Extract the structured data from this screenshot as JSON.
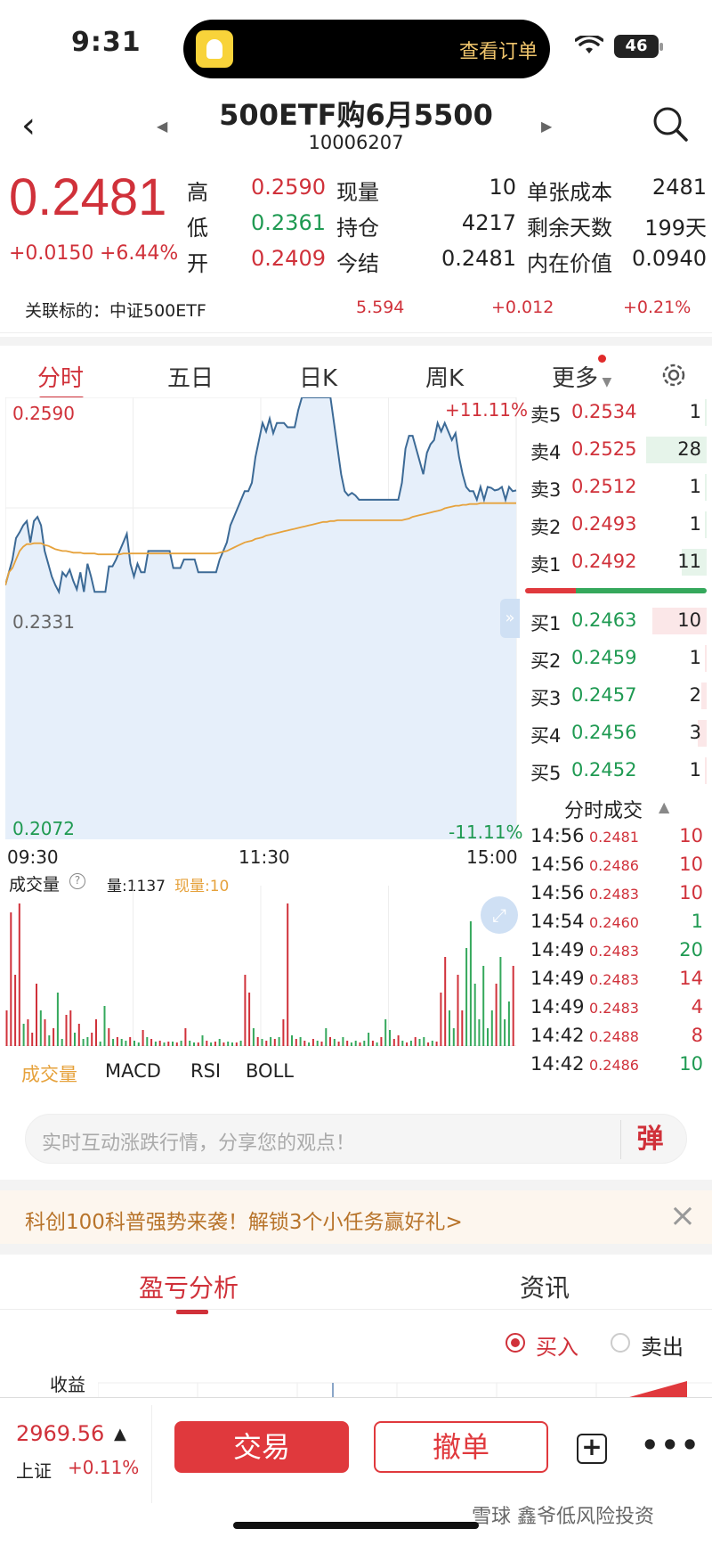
{
  "status": {
    "time": "9:31",
    "island_link": "查看订单",
    "battery": "46"
  },
  "header": {
    "title": "500ETF购6月5500",
    "code": "10006207"
  },
  "quote": {
    "price": "0.2481",
    "change": "+0.0150",
    "change_pct": "+6.44%",
    "rows": [
      [
        {
          "l": "高",
          "v": "0.2590"
        },
        {
          "l": "现量",
          "v": "10"
        },
        {
          "l": "单张成本",
          "v": "2481"
        }
      ],
      [
        {
          "l": "低",
          "v": "0.2361"
        },
        {
          "l": "持仓",
          "v": "4217"
        },
        {
          "l": "剩余天数",
          "v": "199天"
        }
      ],
      [
        {
          "l": "开",
          "v": "0.2409"
        },
        {
          "l": "今结",
          "v": "0.2481"
        },
        {
          "l": "内在价值",
          "v": "0.0940"
        }
      ]
    ]
  },
  "related": {
    "label": "关联标的：中证500ETF",
    "price": "5.594",
    "change": "+0.012",
    "pct": "+0.21%"
  },
  "tabs": [
    "分时",
    "五日",
    "日K",
    "周K",
    "更多"
  ],
  "chart_data": {
    "type": "line",
    "price_max": "0.2590",
    "price_mid": "0.2331",
    "price_min": "0.2072",
    "pct_max": "+11.11%",
    "pct_min": "-11.11%",
    "x_labels": [
      "09:30",
      "11:30",
      "15:00"
    ],
    "ylim": [
      0.2072,
      0.259
    ],
    "series": [
      {
        "values": [
          0.237,
          0.2385,
          0.24,
          0.2425,
          0.2432,
          0.244,
          0.2445,
          0.242,
          0.2445,
          0.245,
          0.244,
          0.241,
          0.2395,
          0.238,
          0.237,
          0.2362,
          0.2385,
          0.238,
          0.2388,
          0.2375,
          0.2365,
          0.2385,
          0.2362,
          0.2395,
          0.238,
          0.2362,
          0.2362,
          0.2362,
          0.2362,
          0.2392,
          0.2392,
          0.24,
          0.241,
          0.242,
          0.243,
          0.2395,
          0.238,
          0.2395,
          0.2385,
          0.2385,
          0.241,
          0.241,
          0.241,
          0.241,
          0.241,
          0.241,
          0.241,
          0.239,
          0.239,
          0.239,
          0.24,
          0.24,
          0.24,
          0.24,
          0.2385,
          0.2385,
          0.2385,
          0.2385,
          0.2385,
          0.2385,
          0.24,
          0.241,
          0.242,
          0.244,
          0.245,
          0.246,
          0.247,
          0.248,
          0.248,
          0.249,
          0.252,
          0.254,
          0.256,
          0.255,
          0.2565,
          0.2548,
          0.256,
          0.256,
          0.256,
          0.2555,
          0.2555,
          0.2555,
          0.2575,
          0.259,
          0.259,
          0.259,
          0.259,
          0.259,
          0.259,
          0.259,
          0.259,
          0.259,
          0.256,
          0.253,
          0.25,
          0.248,
          0.2475,
          0.2478,
          0.2475,
          0.247,
          0.247,
          0.247,
          0.247,
          0.247,
          0.247,
          0.247,
          0.247,
          0.247,
          0.247,
          0.247,
          0.247,
          0.249,
          0.253,
          0.2545,
          0.2545,
          0.253,
          0.2515,
          0.25,
          0.2525,
          0.2535,
          0.254,
          0.256,
          0.255,
          0.256,
          0.255,
          0.254,
          0.2548,
          0.252,
          0.25,
          0.2485,
          0.248,
          0.248,
          0.247,
          0.2485,
          0.247,
          0.2485,
          0.2484,
          0.2481,
          0.2482,
          0.2485,
          0.247,
          0.2485,
          0.248,
          0.2481
        ]
      },
      {
        "values": [
          0.237,
          0.2385,
          0.239,
          0.24,
          0.241,
          0.2415,
          0.2418,
          0.2418,
          0.2419,
          0.2419,
          0.2419,
          0.2417,
          0.2416,
          0.2414,
          0.2412,
          0.2411,
          0.241,
          0.241,
          0.2409,
          0.2408,
          0.2408,
          0.2408,
          0.2407,
          0.2407,
          0.2407,
          0.2407,
          0.2406,
          0.2406,
          0.2406,
          0.2406,
          0.2406,
          0.2406,
          0.2406,
          0.2407,
          0.2407,
          0.2407,
          0.2407,
          0.2407,
          0.2407,
          0.2407,
          0.2407,
          0.2407,
          0.2407,
          0.2407,
          0.2407,
          0.2407,
          0.2407,
          0.2407,
          0.2407,
          0.2407,
          0.2407,
          0.2407,
          0.2407,
          0.2407,
          0.2407,
          0.2407,
          0.2407,
          0.2407,
          0.2407,
          0.2407,
          0.2408,
          0.2409,
          0.241,
          0.2412,
          0.2414,
          0.2416,
          0.2418,
          0.242,
          0.2421,
          0.2422,
          0.2424,
          0.2425,
          0.2426,
          0.2428,
          0.2429,
          0.243,
          0.2431,
          0.2432,
          0.2433,
          0.2434,
          0.2435,
          0.2436,
          0.2437,
          0.2438,
          0.2439,
          0.244,
          0.2441,
          0.2442,
          0.2443,
          0.2444,
          0.2444,
          0.2445,
          0.2445,
          0.2446,
          0.2446,
          0.2446,
          0.2446,
          0.2446,
          0.2446,
          0.2446,
          0.2446,
          0.2446,
          0.2446,
          0.2446,
          0.2446,
          0.2446,
          0.2446,
          0.2446,
          0.2446,
          0.2446,
          0.2446,
          0.2446,
          0.2447,
          0.2448,
          0.245,
          0.2451,
          0.2452,
          0.2453,
          0.2454,
          0.2455,
          0.2456,
          0.2457,
          0.2458,
          0.246,
          0.2461,
          0.2462,
          0.2463,
          0.2463,
          0.2464,
          0.2464,
          0.2465,
          0.2465,
          0.2465,
          0.2466,
          0.2466,
          0.2466,
          0.2466,
          0.2466,
          0.2466,
          0.2466,
          0.2466,
          0.2466,
          0.2466,
          0.2466
        ]
      }
    ],
    "colors": {
      "price": "#3c6a96",
      "avg": "#e6a23c",
      "fill": "#e6effa"
    }
  },
  "order_book": {
    "sell": [
      {
        "l": "卖5",
        "p": "0.2534",
        "q": "1",
        "bar": 0.03
      },
      {
        "l": "卖4",
        "p": "0.2525",
        "q": "28",
        "bar": 0.85
      },
      {
        "l": "卖3",
        "p": "0.2512",
        "q": "1",
        "bar": 0.03
      },
      {
        "l": "卖2",
        "p": "0.2493",
        "q": "1",
        "bar": 0.03
      },
      {
        "l": "卖1",
        "p": "0.2492",
        "q": "11",
        "bar": 0.35
      }
    ],
    "buy": [
      {
        "l": "买1",
        "p": "0.2463",
        "q": "10",
        "bar": 0.76
      },
      {
        "l": "买2",
        "p": "0.2459",
        "q": "1",
        "bar": 0.03
      },
      {
        "l": "买3",
        "p": "0.2457",
        "q": "2",
        "bar": 0.07
      },
      {
        "l": "买4",
        "p": "0.2456",
        "q": "3",
        "bar": 0.12
      },
      {
        "l": "买5",
        "p": "0.2452",
        "q": "1",
        "bar": 0.03
      }
    ]
  },
  "trades_header": "分时成交",
  "trades": [
    {
      "t": "14:56",
      "p": "0.2481",
      "q": "10",
      "c": "red"
    },
    {
      "t": "14:56",
      "p": "0.2486",
      "q": "10",
      "c": "red"
    },
    {
      "t": "14:56",
      "p": "0.2483",
      "q": "10",
      "c": "red"
    },
    {
      "t": "14:54",
      "p": "0.2460",
      "q": "1",
      "c": "green"
    },
    {
      "t": "14:49",
      "p": "0.2483",
      "q": "20",
      "c": "green"
    },
    {
      "t": "14:49",
      "p": "0.2483",
      "q": "14",
      "c": "red"
    },
    {
      "t": "14:49",
      "p": "0.2483",
      "q": "4",
      "c": "red"
    },
    {
      "t": "14:42",
      "p": "0.2488",
      "q": "8",
      "c": "red"
    },
    {
      "t": "14:42",
      "p": "0.2486",
      "q": "10",
      "c": "green"
    }
  ],
  "volume": {
    "label": "成交量",
    "qty": "量:1137",
    "cur": "现量:10",
    "bars": [
      [
        40,
        "r"
      ],
      [
        150,
        "r"
      ],
      [
        80,
        "r"
      ],
      [
        160,
        "r"
      ],
      [
        25,
        "g"
      ],
      [
        30,
        "r"
      ],
      [
        15,
        "r"
      ],
      [
        70,
        "r"
      ],
      [
        40,
        "g"
      ],
      [
        30,
        "r"
      ],
      [
        12,
        "g"
      ],
      [
        20,
        "r"
      ],
      [
        60,
        "g"
      ],
      [
        8,
        "g"
      ],
      [
        35,
        "r"
      ],
      [
        40,
        "r"
      ],
      [
        15,
        "g"
      ],
      [
        25,
        "r"
      ],
      [
        8,
        "g"
      ],
      [
        10,
        "g"
      ],
      [
        15,
        "r"
      ],
      [
        30,
        "r"
      ],
      [
        5,
        "g"
      ],
      [
        45,
        "g"
      ],
      [
        20,
        "r"
      ],
      [
        8,
        "g"
      ],
      [
        10,
        "r"
      ],
      [
        8,
        "g"
      ],
      [
        6,
        "g"
      ],
      [
        10,
        "r"
      ],
      [
        6,
        "g"
      ],
      [
        4,
        "g"
      ],
      [
        18,
        "r"
      ],
      [
        10,
        "g"
      ],
      [
        8,
        "r"
      ],
      [
        5,
        "g"
      ],
      [
        6,
        "r"
      ],
      [
        4,
        "g"
      ],
      [
        5,
        "r"
      ],
      [
        5,
        "g"
      ],
      [
        4,
        "r"
      ],
      [
        6,
        "g"
      ],
      [
        20,
        "r"
      ],
      [
        6,
        "g"
      ],
      [
        4,
        "g"
      ],
      [
        4,
        "r"
      ],
      [
        12,
        "g"
      ],
      [
        6,
        "r"
      ],
      [
        4,
        "g"
      ],
      [
        5,
        "r"
      ],
      [
        8,
        "g"
      ],
      [
        4,
        "r"
      ],
      [
        5,
        "g"
      ],
      [
        4,
        "g"
      ],
      [
        4,
        "r"
      ],
      [
        6,
        "g"
      ],
      [
        80,
        "r"
      ],
      [
        60,
        "r"
      ],
      [
        20,
        "g"
      ],
      [
        10,
        "r"
      ],
      [
        8,
        "g"
      ],
      [
        6,
        "r"
      ],
      [
        10,
        "g"
      ],
      [
        8,
        "r"
      ],
      [
        10,
        "g"
      ],
      [
        30,
        "r"
      ],
      [
        160,
        "r"
      ],
      [
        12,
        "g"
      ],
      [
        8,
        "r"
      ],
      [
        10,
        "g"
      ],
      [
        6,
        "r"
      ],
      [
        4,
        "g"
      ],
      [
        8,
        "r"
      ],
      [
        6,
        "g"
      ],
      [
        5,
        "r"
      ],
      [
        20,
        "g"
      ],
      [
        10,
        "r"
      ],
      [
        8,
        "g"
      ],
      [
        5,
        "r"
      ],
      [
        10,
        "g"
      ],
      [
        6,
        "r"
      ],
      [
        4,
        "g"
      ],
      [
        6,
        "g"
      ],
      [
        4,
        "r"
      ],
      [
        6,
        "g"
      ],
      [
        15,
        "g"
      ],
      [
        6,
        "r"
      ],
      [
        4,
        "g"
      ],
      [
        10,
        "r"
      ],
      [
        30,
        "g"
      ],
      [
        18,
        "g"
      ],
      [
        8,
        "r"
      ],
      [
        12,
        "r"
      ],
      [
        6,
        "g"
      ],
      [
        4,
        "r"
      ],
      [
        6,
        "g"
      ],
      [
        10,
        "r"
      ],
      [
        8,
        "g"
      ],
      [
        10,
        "g"
      ],
      [
        4,
        "r"
      ],
      [
        6,
        "g"
      ],
      [
        5,
        "r"
      ],
      [
        60,
        "r"
      ],
      [
        100,
        "r"
      ],
      [
        40,
        "g"
      ],
      [
        20,
        "g"
      ],
      [
        80,
        "r"
      ],
      [
        40,
        "r"
      ],
      [
        110,
        "g"
      ],
      [
        140,
        "g"
      ],
      [
        70,
        "g"
      ],
      [
        30,
        "g"
      ],
      [
        90,
        "g"
      ],
      [
        20,
        "g"
      ],
      [
        40,
        "g"
      ],
      [
        70,
        "r"
      ],
      [
        100,
        "g"
      ],
      [
        30,
        "g"
      ],
      [
        50,
        "g"
      ],
      [
        90,
        "r"
      ]
    ]
  },
  "indicator_tabs": [
    "成交量",
    "MACD",
    "RSI",
    "BOLL"
  ],
  "comment_placeholder": "实时互动涨跌行情，分享您的观点！",
  "danmu": "弹",
  "promo": "科创100科普强势来袭！解锁3个小任务赢好礼>",
  "bottom_tabs": {
    "pnl": "盈亏分析",
    "news": "资讯"
  },
  "radio": {
    "buy": "买入",
    "sell": "卖出"
  },
  "pnl_ylabel": "收益",
  "index": {
    "value": "2969.56",
    "name": "上证",
    "change": "+0.11%"
  },
  "buttons": {
    "trade": "交易",
    "cancel": "撤单"
  },
  "watermark": "雪球 鑫爷低风险投资"
}
